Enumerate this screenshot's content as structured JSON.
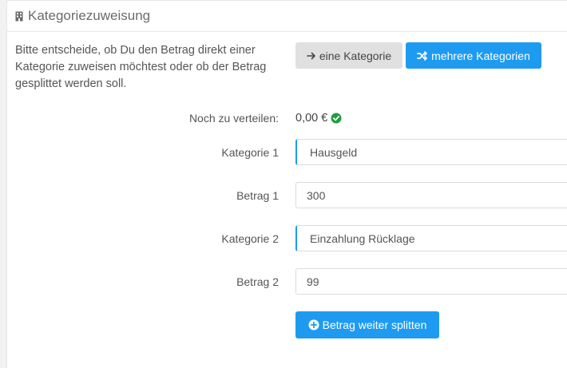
{
  "header": {
    "title": "Kategoriezuweisung",
    "icon": "building-icon"
  },
  "intro": {
    "text": "Bitte entscheide, ob Du den Betrag direkt einer Kategorie zuweisen möchtest oder ob der Betrag gesplittet werden soll."
  },
  "mode_buttons": {
    "one_label": "eine Kategorie",
    "many_label": "mehrere Kategorien"
  },
  "remaining": {
    "label": "Noch zu verteilen:",
    "value": "0,00 €"
  },
  "rows": [
    {
      "label": "Kategorie 1",
      "value": "Hausgeld"
    },
    {
      "label": "Betrag 1",
      "value": "300"
    },
    {
      "label": "Kategorie 2",
      "value": "Einzahlung Rücklage"
    },
    {
      "label": "Betrag 2",
      "value": "99"
    }
  ],
  "split_button": {
    "label": "Betrag weiter splitten"
  },
  "colors": {
    "accent": "#1e9bf0",
    "success": "#1f9d3a"
  }
}
